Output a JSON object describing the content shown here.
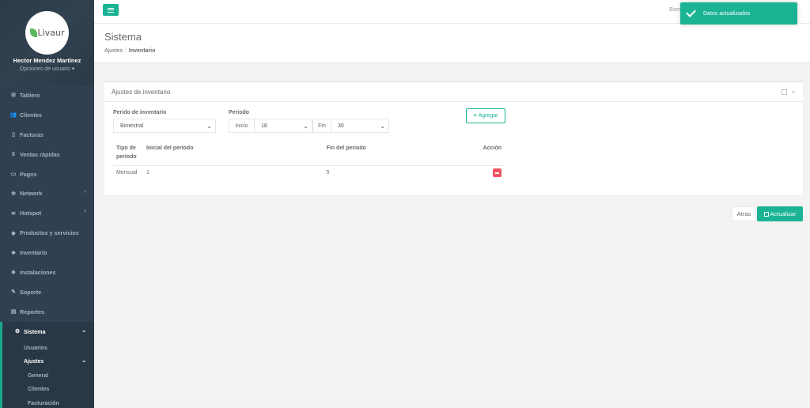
{
  "sidebar": {
    "logo_text": "Livaur",
    "user_name": "Hector Mendez Martínez",
    "user_options": "Opciones de usuario ▾",
    "items": [
      {
        "label": "Tablero",
        "icon": "dashboard-icon",
        "glyph": "⊞"
      },
      {
        "label": "Clientes",
        "icon": "users-icon",
        "glyph": "👥"
      },
      {
        "label": "Facturas",
        "icon": "file-icon",
        "glyph": "▯"
      },
      {
        "label": "Ventas rápidas",
        "icon": "dollar-icon",
        "glyph": "$"
      },
      {
        "label": "Pagos",
        "icon": "money-icon",
        "glyph": "▭"
      },
      {
        "label": "Network",
        "icon": "network-icon",
        "glyph": "✻"
      },
      {
        "label": "Hotspot",
        "icon": "wifi-icon",
        "glyph": "≋"
      },
      {
        "label": "Productos y servicios",
        "icon": "tag-icon",
        "glyph": "◆"
      },
      {
        "label": "Inventario",
        "icon": "cubes-icon",
        "glyph": "❖"
      },
      {
        "label": "Instalaciones",
        "icon": "wrench-icon",
        "glyph": "◈"
      },
      {
        "label": "Soporte",
        "icon": "tools-icon",
        "glyph": "✎"
      },
      {
        "label": "Reportes",
        "icon": "book-icon",
        "glyph": "▤"
      },
      {
        "label": "Sistema",
        "icon": "gears-icon",
        "glyph": "⚙"
      }
    ],
    "system_sub": {
      "usuarios": "Usuarios",
      "ajustes": "Ajustes",
      "general": "General",
      "clientes": "Clientes",
      "facturacion": "Facturación"
    }
  },
  "topbar": {
    "welcome": "Bien"
  },
  "toast": {
    "message": "Datos actualizados"
  },
  "heading": {
    "title": "Sistema",
    "crumb_parent": "Ajustes",
    "crumb_current": "Inventario"
  },
  "panel": {
    "title": "Ajustes de inventario",
    "period_label": "Perido de inventario",
    "period_value": "Bimestral",
    "range_label": "Periodo",
    "start_label": "Inicio",
    "start_value": "18",
    "end_label": "Fin",
    "end_value": "30",
    "add_label": "Agregar",
    "table": {
      "headers": [
        "Tipo de periodo",
        "Inicial del periodo",
        "Fin del periodo",
        "Acción"
      ],
      "rows": [
        {
          "tipo": "Mensual",
          "inicio": "1",
          "fin": "5"
        }
      ]
    }
  },
  "actions": {
    "back": "Atras",
    "update": "Actualizar"
  },
  "colors": {
    "accent": "#1ab394",
    "sidebar": "#2f4050",
    "danger": "#ed5565"
  }
}
